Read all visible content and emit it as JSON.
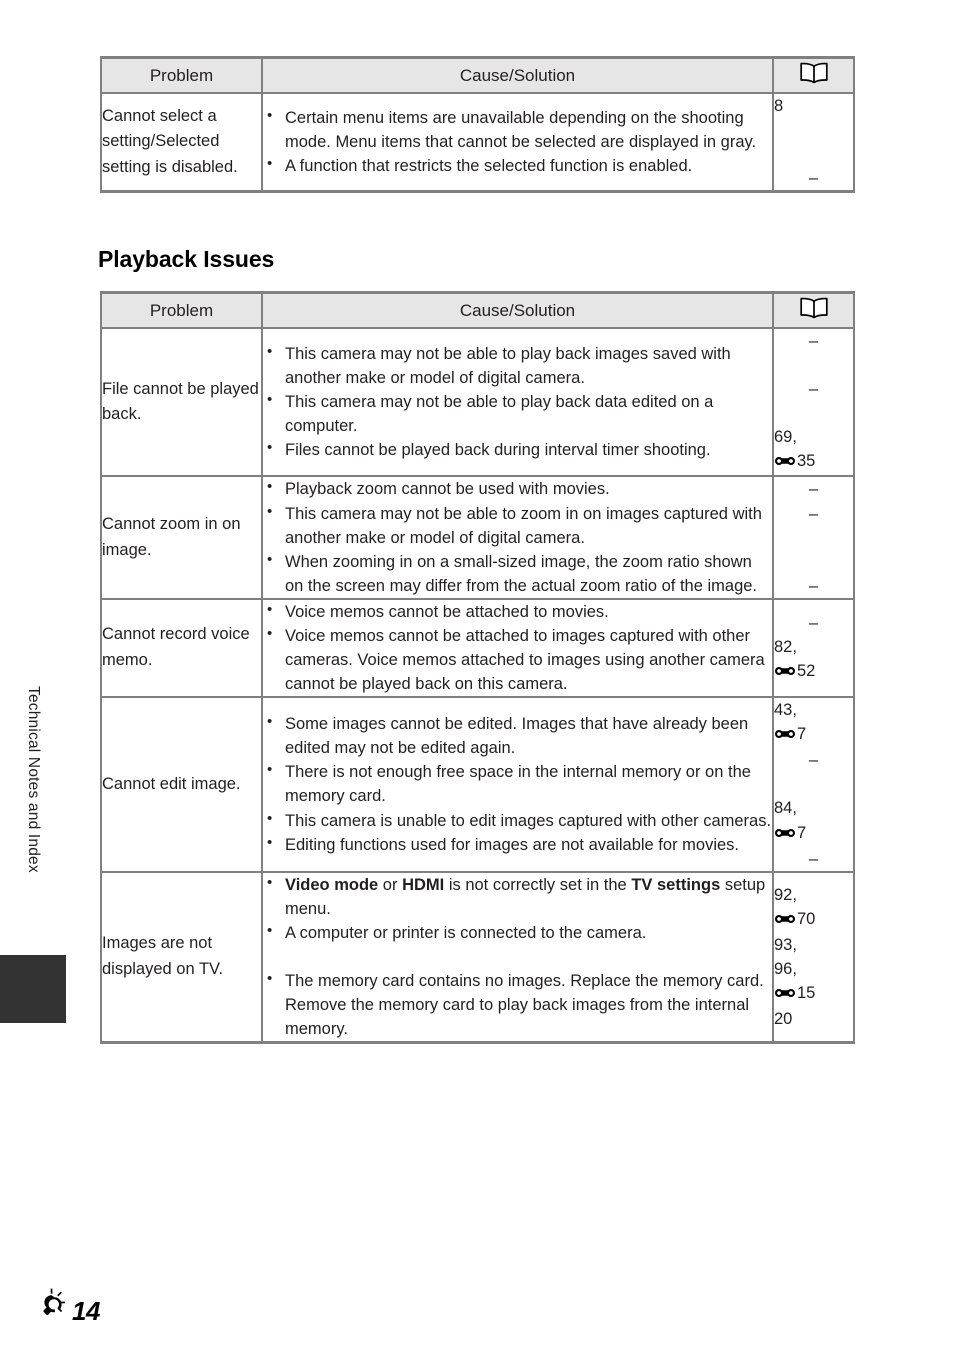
{
  "page": {
    "sidebar_label": "Technical Notes and Index",
    "footer_icon": "lightbulb-icon",
    "footer_page_number": "14",
    "book_icon_name": "open-book-icon",
    "ref_icon_name": "nikon-reference-mark-icon"
  },
  "colors": {
    "border": "#808080",
    "header_bg": "#e6e6e6",
    "text": "#231f20",
    "tab_marker": "#333333"
  },
  "headings": {
    "playback_issues": "Playback Issues"
  },
  "table_headers": {
    "problem": "Problem",
    "cause_solution": "Cause/Solution",
    "reference": "book-icon"
  },
  "shooting_table": {
    "rows": [
      {
        "problem": "Cannot select a setting/Selected setting is disabled.",
        "causes": [
          {
            "text": "Certain menu items are unavailable depending on the shooting mode. Menu items that cannot be selected are displayed in gray."
          },
          {
            "text": "A function that restricts the selected function is enabled."
          }
        ],
        "refs": [
          {
            "value": "8",
            "style": "plain"
          },
          {
            "value": "",
            "style": "spacer"
          },
          {
            "value": "",
            "style": "spacer"
          },
          {
            "value": "–",
            "style": "dash"
          }
        ]
      }
    ]
  },
  "playback_table": {
    "rows": [
      {
        "problem": "File cannot be played back.",
        "causes": [
          {
            "text": "This camera may not be able to play back images saved with another make or model of digital camera."
          },
          {
            "text": "This camera may not be able to play back data edited on a computer."
          },
          {
            "text": "Files cannot be played back during interval timer shooting."
          }
        ],
        "refs": [
          {
            "value": "–",
            "style": "dash"
          },
          {
            "value": "",
            "style": "spacer"
          },
          {
            "value": "–",
            "style": "dash"
          },
          {
            "value": "",
            "style": "spacer"
          },
          {
            "value": "69,",
            "style": "plain"
          },
          {
            "value": "35",
            "style": "refmark"
          }
        ]
      },
      {
        "problem": "Cannot zoom in on image.",
        "causes": [
          {
            "text": "Playback zoom cannot be used with movies."
          },
          {
            "text": "This camera may not be able to zoom in on images captured with another make or model of digital camera."
          },
          {
            "text": "When zooming in on a small-sized image, the zoom ratio shown on the screen may differ from the actual zoom ratio of the image."
          }
        ],
        "refs": [
          {
            "value": "–",
            "style": "dash"
          },
          {
            "value": "–",
            "style": "dash"
          },
          {
            "value": "",
            "style": "spacer"
          },
          {
            "value": "",
            "style": "spacer"
          },
          {
            "value": "–",
            "style": "dash"
          }
        ]
      },
      {
        "problem": "Cannot record voice memo.",
        "causes": [
          {
            "text": "Voice memos cannot be attached to movies."
          },
          {
            "text": "Voice memos cannot be attached to images captured with other cameras. Voice memos attached to images using another camera cannot be played back on this camera."
          }
        ],
        "refs": [
          {
            "value": "–",
            "style": "dash"
          },
          {
            "value": "82,",
            "style": "plain"
          },
          {
            "value": "52",
            "style": "refmark"
          }
        ]
      },
      {
        "problem": "Cannot edit image.",
        "causes": [
          {
            "text": "Some images cannot be edited. Images that have already been edited may not be edited again."
          },
          {
            "text": "There is not enough free space in the internal memory or on the memory card."
          },
          {
            "text": "This camera is unable to edit images captured with other cameras."
          },
          {
            "text": "Editing functions used for images are not available for movies."
          }
        ],
        "refs": [
          {
            "value": "43,",
            "style": "plain"
          },
          {
            "value": "7",
            "style": "refmark"
          },
          {
            "value": "–",
            "style": "dash"
          },
          {
            "value": "",
            "style": "spacer"
          },
          {
            "value": "84,",
            "style": "plain"
          },
          {
            "value": "7",
            "style": "refmark"
          },
          {
            "value": "–",
            "style": "dash"
          }
        ]
      },
      {
        "problem": "Images are not displayed on TV.",
        "causes": [
          {
            "segments": [
              {
                "text": "Video mode",
                "bold": true
              },
              {
                "text": " or ",
                "bold": false
              },
              {
                "text": "HDMI",
                "bold": true
              },
              {
                "text": " is not correctly set in the ",
                "bold": false
              },
              {
                "text": "TV settings",
                "bold": true
              },
              {
                "text": " setup menu.",
                "bold": false
              }
            ]
          },
          {
            "text": "A computer or printer is connected to the camera."
          },
          {
            "text": "",
            "blank": true
          },
          {
            "text": "The memory card contains no images. Replace the memory card. Remove the memory card to play back images from the internal memory."
          }
        ],
        "refs": [
          {
            "value": "92,",
            "style": "plain"
          },
          {
            "value": "70",
            "style": "refmark"
          },
          {
            "value": "93,",
            "style": "plain"
          },
          {
            "value": "96,",
            "style": "plain"
          },
          {
            "value": "15",
            "style": "refmark"
          },
          {
            "value": "20",
            "style": "plain"
          }
        ]
      }
    ]
  }
}
